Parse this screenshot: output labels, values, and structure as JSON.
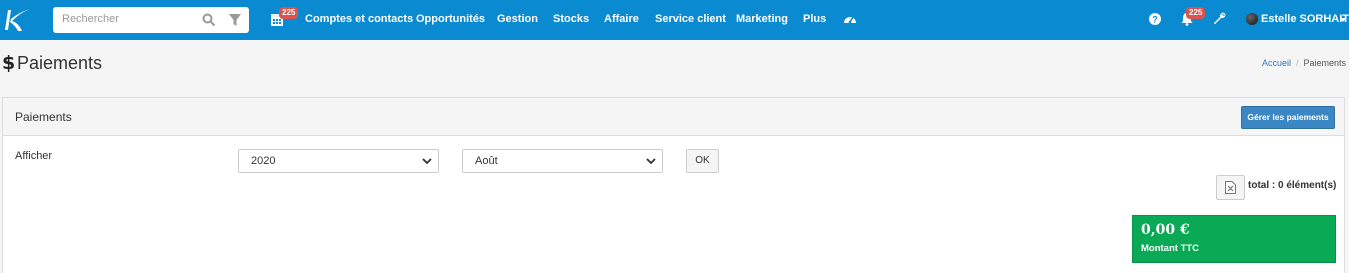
{
  "navbar": {
    "search_placeholder": "Rechercher",
    "calendar_badge": "225",
    "items": [
      {
        "label": "Comptes et contacts"
      },
      {
        "label": "Opportunités"
      },
      {
        "label": "Gestion"
      },
      {
        "label": "Stocks"
      },
      {
        "label": "Affaire"
      },
      {
        "label": "Service client"
      },
      {
        "label": "Marketing"
      },
      {
        "label": "Plus"
      }
    ],
    "notifications_badge": "225",
    "user_name": "Estelle SORHAITZ",
    "color": "#0a8ad1"
  },
  "page": {
    "icon": "dollar-icon",
    "title": "Paiements",
    "breadcrumb": {
      "home": "Accueil",
      "separator": "/",
      "current": "Paiements"
    }
  },
  "panel": {
    "title": "Paiements",
    "manage_button": "Gérer les paiements",
    "filter_label": "Afficher",
    "year_select": "2020",
    "month_select": "Août",
    "ok_button": "OK",
    "total_text": "total : 0 élément(s)",
    "amount": {
      "value": "0,00 €",
      "label": "Montant TTC",
      "color": "#0aa955"
    }
  }
}
